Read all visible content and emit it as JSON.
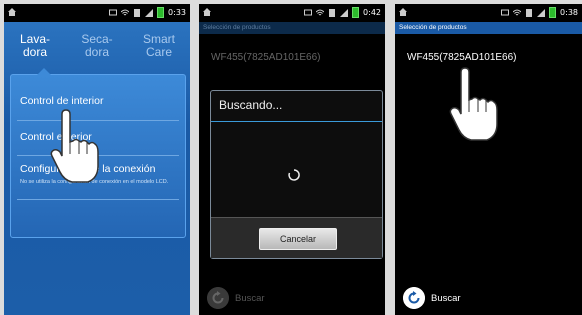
{
  "screens": [
    {
      "status": {
        "time": "0:33"
      },
      "tabs": [
        {
          "label": "Lava-\ndora"
        },
        {
          "label": "Seca-\ndora"
        },
        {
          "label": "Smart\nCare"
        }
      ],
      "menu": {
        "items": [
          {
            "label": "Control de interior"
          },
          {
            "label": "Control exterior"
          },
          {
            "label": "Configuración de la conexión"
          }
        ],
        "note": "No se utiliza la configuración de conexión en el modelo LCD."
      }
    },
    {
      "status": {
        "time": "0:42"
      },
      "header": "Selección de productos",
      "device": "WF455(7825AD101E66)",
      "dialog": {
        "title": "Buscando...",
        "cancel_label": "Cancelar"
      },
      "bottom": {
        "search_label": "Buscar"
      }
    },
    {
      "status": {
        "time": "0:38"
      },
      "header": "Selección de productos",
      "device": "WF455(7825AD101E66)",
      "bottom": {
        "search_label": "Buscar"
      }
    }
  ],
  "icons": [
    "home-icon",
    "screen-icon",
    "wifi-icon",
    "sim-icon",
    "signal-icon",
    "battery-icon",
    "refresh-icon",
    "pointing-hand-icon",
    "loading-spinner-icon"
  ],
  "colors": {
    "accent": "#1a5aa6",
    "dialog_line": "#3a9ad9"
  }
}
